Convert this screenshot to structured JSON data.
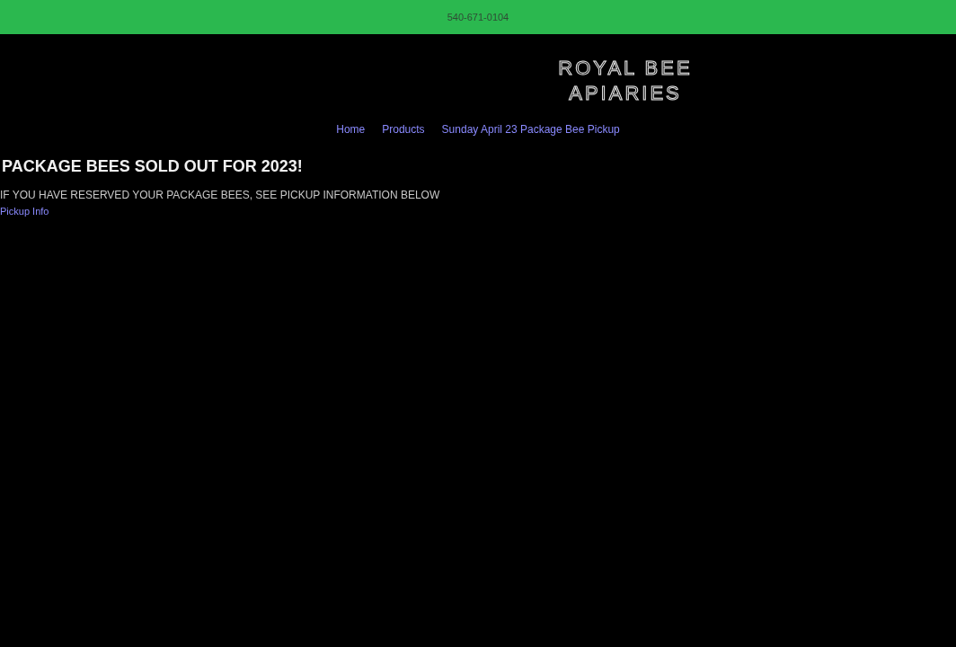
{
  "top_bar": {
    "phone": "540-671-0104"
  },
  "logo": {
    "lines": [
      "ROYAL BEE",
      "APIARIES"
    ]
  },
  "nav": {
    "items": [
      {
        "label": "Home"
      },
      {
        "label": "Products"
      },
      {
        "label": "Sunday April 23 Package Bee Pickup"
      }
    ]
  },
  "notice": {
    "heading": "PACKAGE BEES SOLD OUT FOR 2023!",
    "text": "IF YOU HAVE RESERVED YOUR PACKAGE BEES, SEE PICKUP INFORMATION BELOW",
    "link": "Pickup Info"
  }
}
